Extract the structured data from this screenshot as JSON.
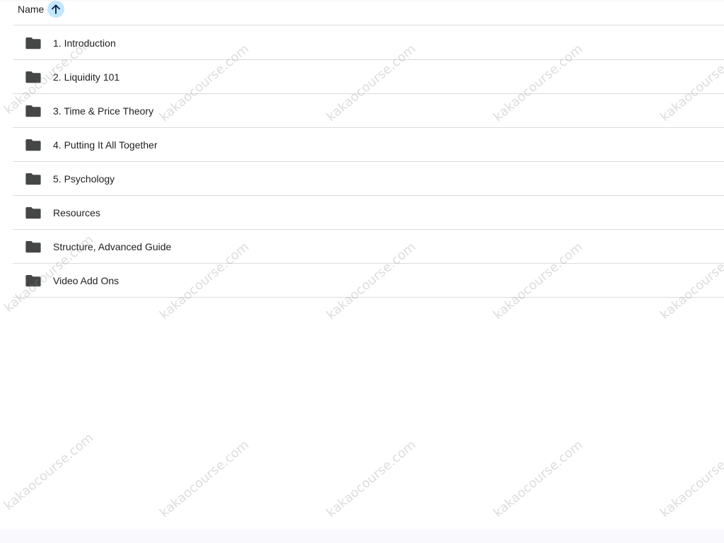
{
  "list": {
    "header": {
      "name_label": "Name",
      "sort_icon": "arrow-up-icon",
      "sort_direction": "ascending"
    },
    "row_icon": "folder-icon",
    "rows": [
      {
        "name": "1. Introduction"
      },
      {
        "name": "2. Liquidity 101"
      },
      {
        "name": "3. Time & Price Theory"
      },
      {
        "name": "4. Putting It All Together"
      },
      {
        "name": "5. Psychology"
      },
      {
        "name": "Resources"
      },
      {
        "name": "Structure, Advanced Guide"
      },
      {
        "name": "Video Add Ons"
      }
    ]
  },
  "watermark": {
    "text": "kakaocourse.com"
  },
  "colors": {
    "sort_button_bg": "#c2e7ff",
    "sort_arrow": "#041e49",
    "folder": "#444746",
    "divider": "#dadce0",
    "text": "#1f1f1f"
  }
}
